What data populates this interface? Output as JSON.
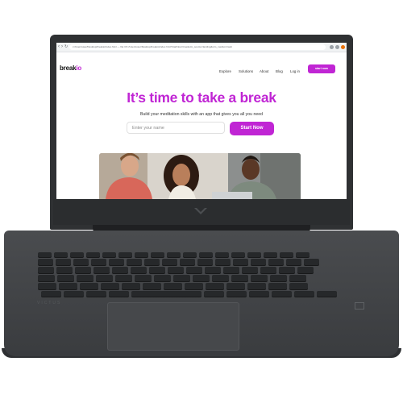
{
  "browser": {
    "url": "c:/Users/user/Desktop/breakio/index.html — file:///C:/Users/user/Desktop/breakio/index.html?startNow=true&utm_source=landing&utm_medium=web",
    "back_icon": "arrow-left-icon",
    "forward_icon": "arrow-right-icon",
    "reload_icon": "reload-icon"
  },
  "site": {
    "logo_main": "break",
    "logo_accent": "io",
    "nav": [
      "Explore",
      "Solutions",
      "About",
      "Blog",
      "Log in"
    ],
    "cta_label": "start now",
    "accent_color": "#c025d4"
  },
  "hero": {
    "title": "It’s time to take a break",
    "subtitle": "Build your meditation skills with an app that gives you all you need",
    "name_placeholder": "Enter your name",
    "button_label": "Start Now"
  },
  "device": {
    "keyboard_brand": "VICTUS"
  }
}
